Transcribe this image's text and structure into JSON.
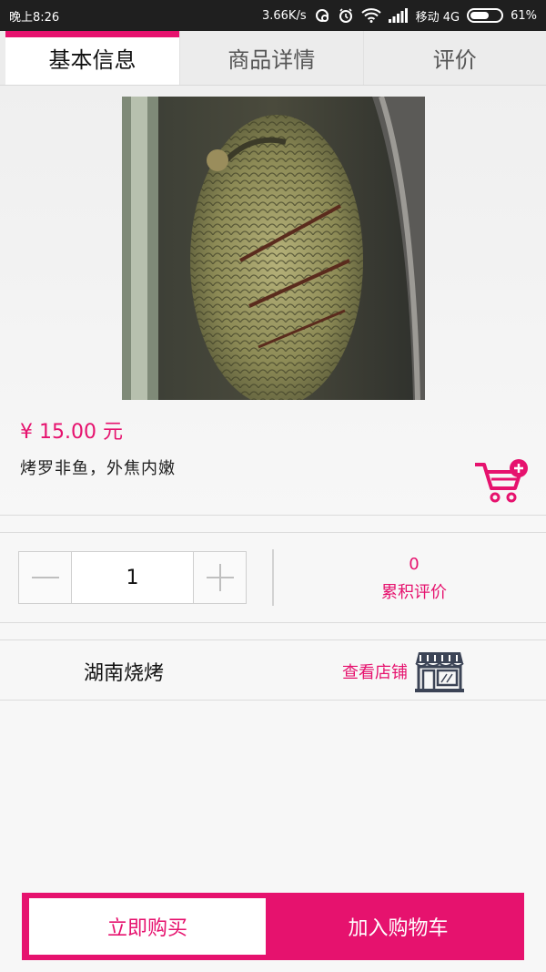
{
  "status_bar": {
    "time": "晚上8:26",
    "speed": "3.66K/s",
    "carrier": "移动 4G",
    "battery": "61%",
    "battery_level": 0.61
  },
  "tabs": [
    {
      "label": "基本信息",
      "active": true
    },
    {
      "label": "商品详情",
      "active": false
    },
    {
      "label": "评价",
      "active": false
    }
  ],
  "product": {
    "image_icon": "grilled-fish-photo",
    "price": "¥ 15.00 元",
    "name": "烤罗非鱼，外焦内嫩"
  },
  "quantity": {
    "value": "1",
    "minus_icon": "minus-icon",
    "plus_icon": "plus-icon"
  },
  "reviews": {
    "count": "0",
    "label": "累积评价"
  },
  "store": {
    "name": "湖南烧烤",
    "view_label": "查看店铺",
    "icon": "storefront-icon"
  },
  "actions": {
    "buy_now": "立即购买",
    "add_to_cart": "加入购物车"
  },
  "colors": {
    "accent": "#e6126e",
    "status_bar": "#1f1f1f"
  }
}
